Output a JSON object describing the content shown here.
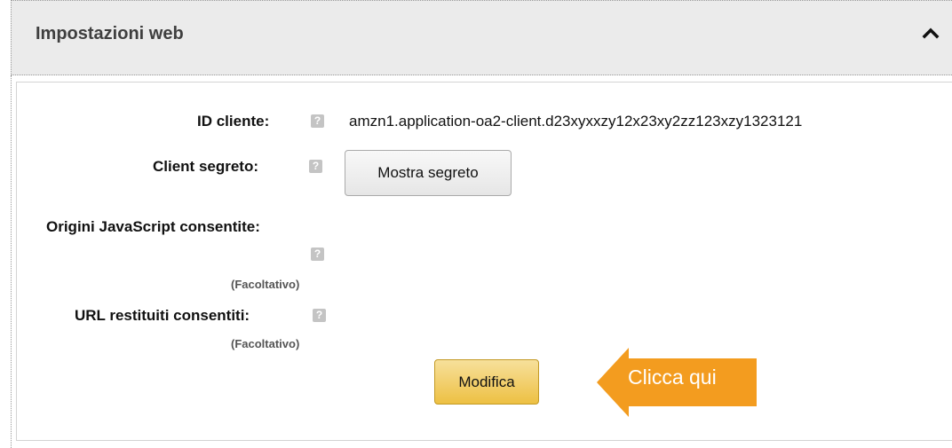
{
  "panel": {
    "title": "Impostazioni web"
  },
  "fields": {
    "client_id": {
      "label": "ID cliente:",
      "value": "amzn1.application-oa2-client.d23xyxxzy12x23xy2zz123xzy1323121"
    },
    "client_secret": {
      "label": "Client segreto:",
      "button_label": "Mostra segreto"
    },
    "js_origins": {
      "label": "Origini JavaScript consentite:",
      "optional": "(Facoltativo)"
    },
    "return_urls": {
      "label": "URL restituiti consentiti:",
      "optional": "(Facoltativo)"
    }
  },
  "help_glyph": "?",
  "actions": {
    "edit_label": "Modifica"
  },
  "callout": {
    "text": "Clicca qui",
    "color": "#f39c1f"
  },
  "colors": {
    "header_bg": "#ebebeb",
    "primary_button": "#edc043",
    "help_icon": "#c4c4c4"
  }
}
